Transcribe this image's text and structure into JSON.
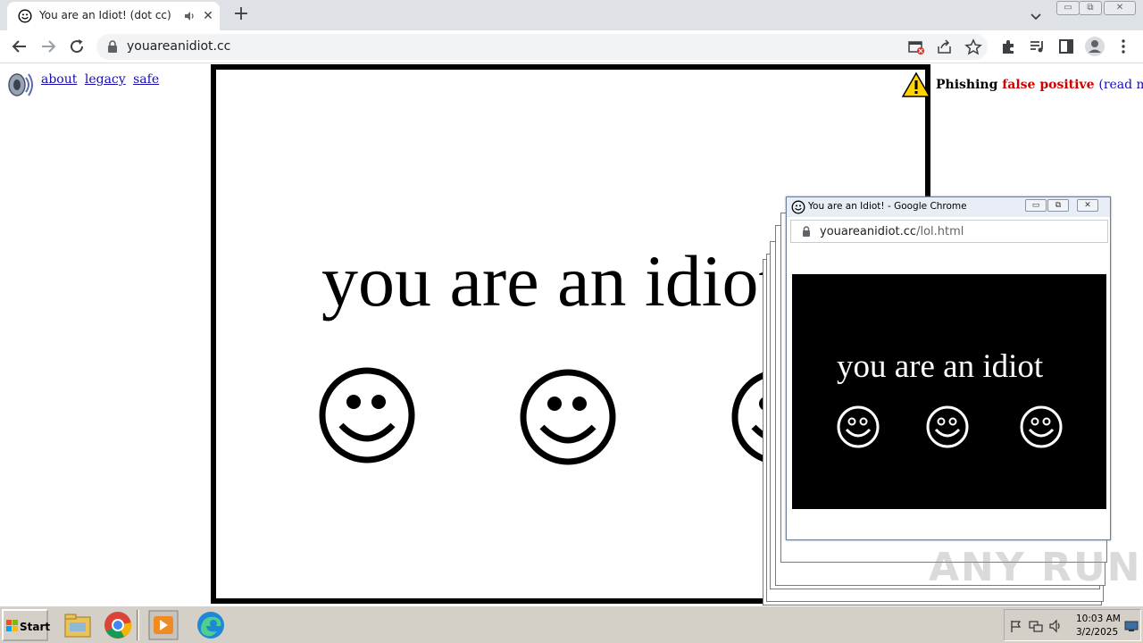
{
  "browser": {
    "tab_title": "You are an Idiot! (dot cc)",
    "tab_close": "✕",
    "new_tab": "+",
    "url": "youareanidiot.cc",
    "window_buttons": [
      "▭",
      "⧉",
      "✕"
    ]
  },
  "page": {
    "links": [
      "about",
      "legacy",
      "safe"
    ],
    "phishing_label": "Phishing",
    "phishing_status": "false positive",
    "read_more": "(read more)",
    "headline": "you are an idiot",
    "colors": {
      "link": "#1a0dab",
      "status_red": "#d00000"
    }
  },
  "popup": {
    "title": "You are an Idiot! - Google Chrome",
    "url_host": "youareanidiot.cc",
    "url_path": "/lol.html",
    "headline": "you are an idiot",
    "buttons": [
      "▭",
      "⧉",
      "✕"
    ]
  },
  "watermark": "ANY RUN",
  "taskbar": {
    "start_label": "Start",
    "apps": [
      "explorer-icon",
      "chrome-icon",
      "media-player-icon",
      "edge-icon"
    ],
    "time": "10:03 AM",
    "date": "3/2/2025"
  }
}
